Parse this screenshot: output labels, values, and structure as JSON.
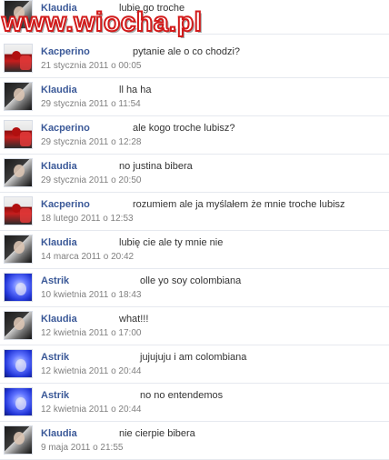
{
  "messages": [
    {
      "sender": "Klaudia",
      "time": "",
      "text": "lubię go troche",
      "avatar": "klaudia-avatar"
    },
    {
      "sender": "Kacperino",
      "time": "21 stycznia 2011 o 00:05",
      "text": "pytanie ale o co chodzi?",
      "avatar": "kacperino-avatar"
    },
    {
      "sender": "Klaudia",
      "time": "29 stycznia 2011 o 11:54",
      "text": "ll ha ha",
      "avatar": "klaudia-avatar"
    },
    {
      "sender": "Kacperino",
      "time": "29 stycznia 2011 o 12:28",
      "text": "ale kogo troche lubisz?",
      "avatar": "kacperino-avatar"
    },
    {
      "sender": "Klaudia",
      "time": "29 stycznia 2011 o 20:50",
      "text": "no justina bibera",
      "avatar": "klaudia-avatar"
    },
    {
      "sender": "Kacperino",
      "time": "18 lutego 2011 o 12:53",
      "text": "rozumiem ale ja myślałem że mnie troche lubisz",
      "avatar": "kacperino-avatar"
    },
    {
      "sender": "Klaudia",
      "time": "14 marca 2011 o 20:42",
      "text": "lubię cie ale ty mnie nie",
      "avatar": "klaudia-avatar"
    },
    {
      "sender": "Astrik",
      "time": "10 kwietnia 2011 o 18:43",
      "text": "olle yo soy colombiana",
      "avatar": "astrik-avatar"
    },
    {
      "sender": "Klaudia",
      "time": "12 kwietnia 2011 o 17:00",
      "text": "what!!!",
      "avatar": "klaudia-avatar"
    },
    {
      "sender": "Astrik",
      "time": "12 kwietnia 2011 o 20:44",
      "text": "jujujuju i am colombiana",
      "avatar": "astrik-avatar"
    },
    {
      "sender": "Astrik",
      "time": "12 kwietnia 2011 o 20:44",
      "text": "no no entendemos",
      "avatar": "astrik-avatar"
    },
    {
      "sender": "Klaudia",
      "time": "9 maja 2011 o 21:55",
      "text": "nie cierpie bibera",
      "avatar": "klaudia-avatar"
    }
  ],
  "watermark": {
    "text": "www.wiocha.pl"
  }
}
